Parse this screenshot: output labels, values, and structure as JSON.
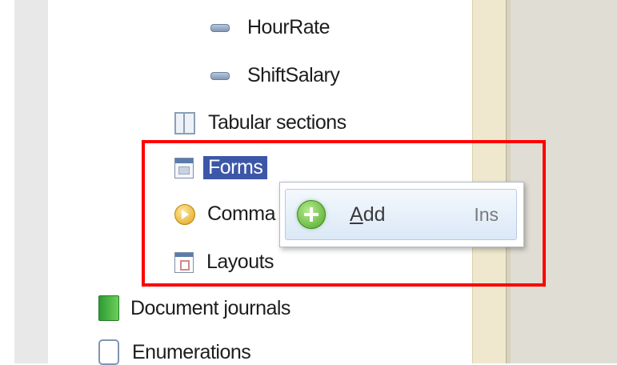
{
  "tree": {
    "items": [
      {
        "id": "hour-rate",
        "label": "HourRate",
        "icon": "attribute-icon"
      },
      {
        "id": "shift-salary",
        "label": "ShiftSalary",
        "icon": "attribute-icon"
      },
      {
        "id": "tabular-sections",
        "label": "Tabular sections",
        "icon": "tabular-section-icon"
      },
      {
        "id": "forms",
        "label": "Forms",
        "icon": "form-icon",
        "selected": true
      },
      {
        "id": "commands",
        "label": "Comma",
        "icon": "command-icon"
      },
      {
        "id": "layouts",
        "label": "Layouts",
        "icon": "layout-icon"
      },
      {
        "id": "document-journals",
        "label": "Document journals",
        "icon": "document-journal-icon"
      },
      {
        "id": "enumerations",
        "label": "Enumerations",
        "icon": "enumeration-icon"
      }
    ]
  },
  "context_menu": {
    "items": [
      {
        "label": "Add",
        "shortcut": "Ins",
        "icon": "add-icon",
        "hotkey_letter": "A"
      }
    ]
  },
  "colors": {
    "selection": "#3c57a8",
    "highlight_box": "#ff0000",
    "menu_hover": "#dbe8f7"
  }
}
